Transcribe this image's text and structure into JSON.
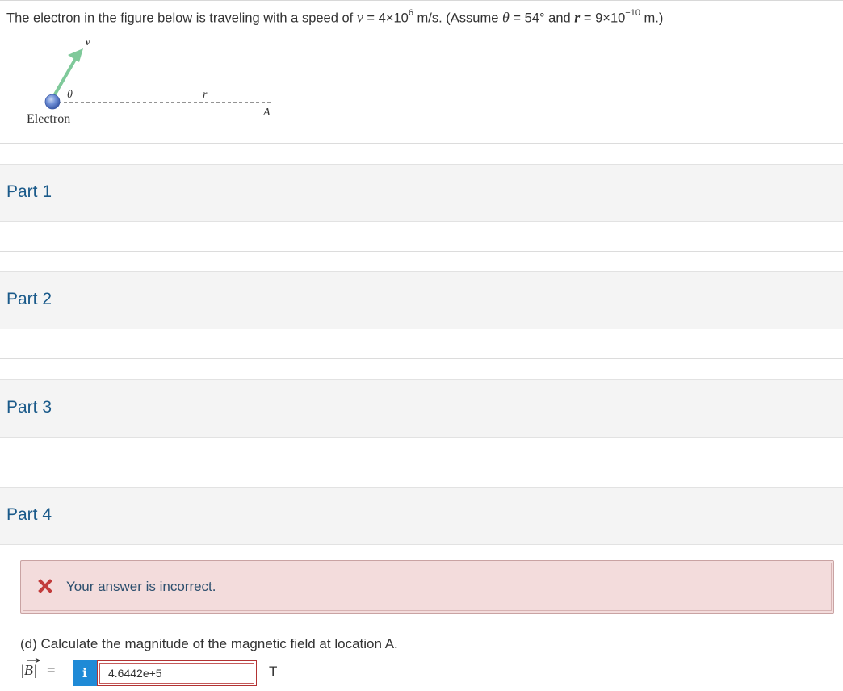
{
  "problem": {
    "lead": "The electron in the figure below is traveling with a speed of ",
    "v_sym": "v",
    "eq1": " = ",
    "v_mant": "4",
    "times": "×",
    "ten": "10",
    "v_exp": "6",
    "v_unit": " m/s. (Assume ",
    "theta_sym": "θ",
    "eq2": " = ",
    "theta_val": "54° and ",
    "r_sym": "r",
    "eq3": " = ",
    "r_mant": "9",
    "r_exp": "−10",
    "r_unit": " m.)"
  },
  "figure": {
    "v_label": "v",
    "theta_label": "θ",
    "r_label": "r",
    "a_label": "A",
    "electron_label": "Electron",
    "arrow_color": "#7fc99a",
    "electron_color": "#4f73c8"
  },
  "parts": [
    {
      "label": "Part 1"
    },
    {
      "label": "Part 2"
    },
    {
      "label": "Part 3"
    },
    {
      "label": "Part 4"
    }
  ],
  "feedback": {
    "icon": "x-mark-icon",
    "message": "Your answer is incorrect.",
    "color": "#c23b3b"
  },
  "question": {
    "text": "(d) Calculate the magnitude of the magnetic field at location A.",
    "field_label": "|B|",
    "equals": "=",
    "info_label": "i",
    "answer_value": "4.6442e+5",
    "unit": "T"
  }
}
